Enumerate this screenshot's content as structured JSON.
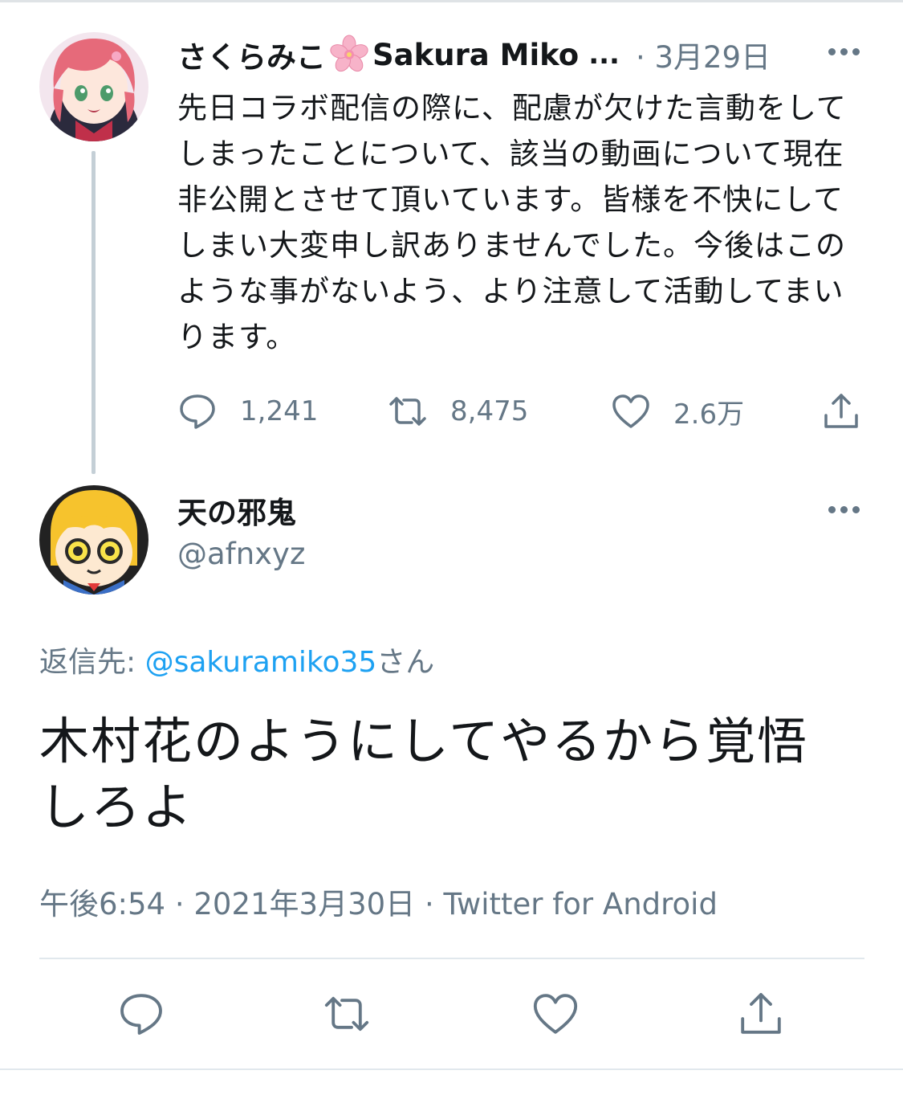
{
  "parent_tweet": {
    "display_name": "さくらみこ",
    "display_name_latin": "Sakura Miko",
    "name_truncation": "...",
    "date": "· 3月29日",
    "text": "先日コラボ配信の際に、配慮が欠けた言動をしてしまったことについて、該当の動画について現在非公開とさせて頂いています。皆様を不快にしてしまい大変申し訳ありませんでした。今後はこのような事がないよう、より注意して活動してまいります。",
    "reply_count": "1,241",
    "retweet_count": "8,475",
    "like_count": "2.6万"
  },
  "main_tweet": {
    "display_name": "天の邪鬼",
    "handle": "@afnxyz",
    "reply_to_label": "返信先: ",
    "reply_to_mention": "@sakuramiko35",
    "reply_to_suffix": "さん",
    "text": "木村花のようにしてやるから覚悟しろよ",
    "time": "午後6:54",
    "date": "2021年3月30日",
    "source": "Twitter for Android",
    "meta_separator": " · "
  },
  "icons": {
    "reply": "reply-icon",
    "retweet": "retweet-icon",
    "like": "heart-icon",
    "share": "share-icon",
    "more": "more-icon",
    "flower": "cherry-blossom-icon"
  },
  "colors": {
    "text": "#14171a",
    "secondary": "#657786",
    "link": "#1da1f2",
    "divider": "#e1e8ed"
  }
}
